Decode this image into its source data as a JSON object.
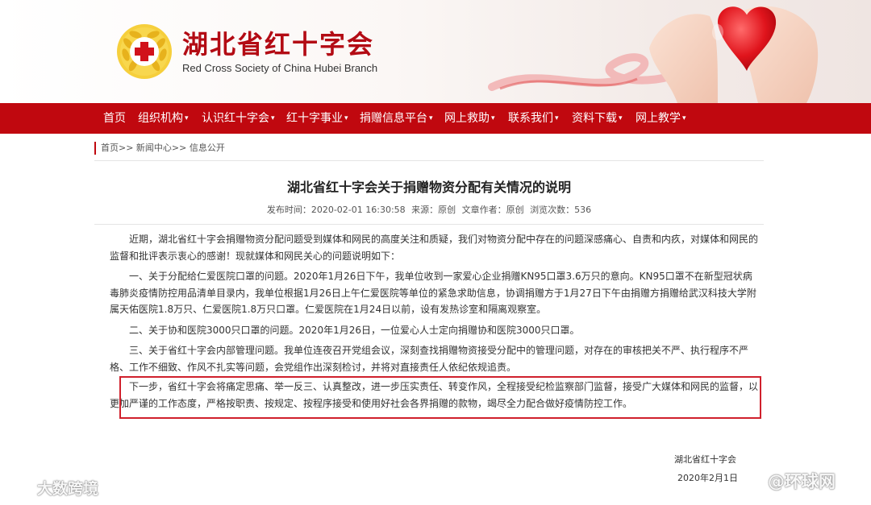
{
  "header": {
    "title": "湖北省红十字会",
    "subtitle": "Red Cross Society of China Hubei Branch",
    "logo_icon": "red-cross-wreath-icon",
    "hero_icon": "heart-in-hands-icon"
  },
  "nav": {
    "items": [
      {
        "label": "首页",
        "has_dropdown": false
      },
      {
        "label": "组织机构",
        "has_dropdown": true
      },
      {
        "label": "认识红十字会",
        "has_dropdown": true
      },
      {
        "label": "红十字事业",
        "has_dropdown": true
      },
      {
        "label": "捐赠信息平台",
        "has_dropdown": true
      },
      {
        "label": "网上救助",
        "has_dropdown": true
      },
      {
        "label": "联系我们",
        "has_dropdown": true
      },
      {
        "label": "资料下载",
        "has_dropdown": true
      },
      {
        "label": "网上教学",
        "has_dropdown": true
      }
    ],
    "dropdown_glyph": "▾"
  },
  "breadcrumb": "首页>> 新闻中心>> 信息公开",
  "article": {
    "title": "湖北省红十字会关于捐赠物资分配有关情况的说明",
    "meta": {
      "published": "发布时间：2020-02-01 16:30:58",
      "source": "来源：原创",
      "author": "文章作者：原创",
      "views": "浏览次数：536"
    },
    "paragraphs": [
      "近期，湖北省红十字会捐赠物资分配问题受到媒体和网民的高度关注和质疑，我们对物资分配中存在的问题深感痛心、自责和内疚，对媒体和网民的监督和批评表示衷心的感谢！现就媒体和网民关心的问题说明如下：",
      "一、关于分配给仁爱医院口罩的问题。2020年1月26日下午，我单位收到一家爱心企业捐赠KN95口罩3.6万只的意向。KN95口罩不在新型冠状病毒肺炎疫情防控用品清单目录内，我单位根据1月26日上午仁爱医院等单位的紧急求助信息，协调捐赠方于1月27日下午由捐赠方捐赠给武汉科技大学附属天佑医院1.8万只、仁爱医院1.8万只口罩。仁爱医院在1月24日以前，设有发热诊室和隔离观察室。",
      "二、关于协和医院3000只口罩的问题。2020年1月26日，一位爱心人士定向捐赠协和医院3000只口罩。",
      "三、关于省红十字会内部管理问题。我单位连夜召开党组会议，深刻查找捐赠物资接受分配中的管理问题，对存在的审核把关不严、执行程序不严格、工作不细致、作风不扎实等问题，会党组作出深刻检讨，并将对直接责任人依纪依规追责。",
      "下一步，省红十字会将痛定思痛、举一反三、认真整改，进一步压实责任、转变作风，全程接受纪检监察部门监督，接受广大媒体和网民的监督，以更加严谨的工作态度，严格按职责、按规定、按程序接受和使用好社会各界捐赠的款物，竭尽全力配合做好疫情防控工作。"
    ],
    "signature_org": "湖北省红十字会",
    "signature_date": "2020年2月1日"
  },
  "watermarks": {
    "left": "大数跨境",
    "right": "@环球网",
    "left_icon": "kuaishou-logo-icon",
    "right_icon": "weibo-logo-icon"
  },
  "colors": {
    "brand_red": "#c0080f",
    "highlight_border": "#d0202c"
  }
}
